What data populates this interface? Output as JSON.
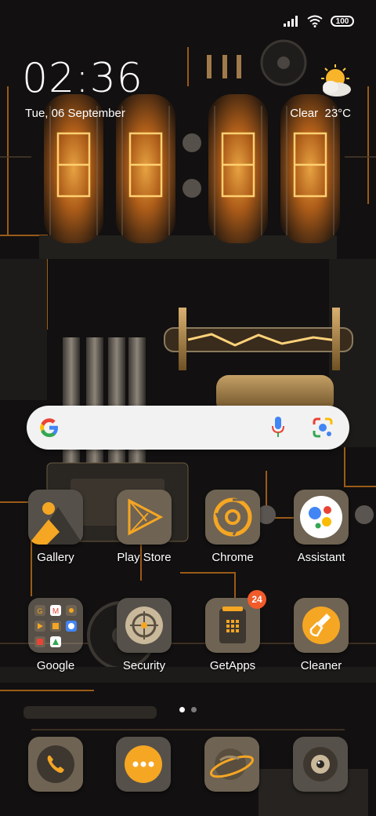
{
  "status_bar": {
    "battery": "100"
  },
  "clock": {
    "time": "02:36",
    "date": "Tue, 06 September"
  },
  "weather": {
    "condition": "Clear",
    "temperature": "23°C"
  },
  "search_bar": {
    "logo": "google-icon",
    "mic": "mic-icon",
    "lens": "lens-icon"
  },
  "apps": [
    {
      "label": "Gallery",
      "icon": "gallery-icon"
    },
    {
      "label": "Play Store",
      "icon": "play-store-icon"
    },
    {
      "label": "Chrome",
      "icon": "chrome-icon"
    },
    {
      "label": "Assistant",
      "icon": "assistant-icon"
    },
    {
      "label": "Google",
      "icon": "folder-icon"
    },
    {
      "label": "Security",
      "icon": "security-icon"
    },
    {
      "label": "GetApps",
      "icon": "getapps-icon",
      "badge": "24"
    },
    {
      "label": "Cleaner",
      "icon": "cleaner-icon"
    }
  ],
  "dock": [
    {
      "icon": "phone-icon"
    },
    {
      "icon": "messages-icon"
    },
    {
      "icon": "browser-icon"
    },
    {
      "icon": "camera-icon"
    }
  ],
  "pager": {
    "pages": 2,
    "active": 0
  },
  "colors": {
    "accent": "#f5a623",
    "tile_gray": "#555049",
    "tile_khaki": "#6f6353",
    "badge": "#f25a2a"
  }
}
